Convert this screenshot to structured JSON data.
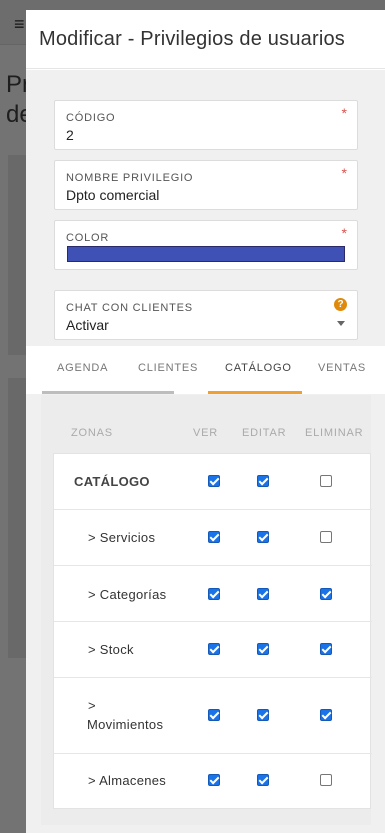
{
  "modal": {
    "title": "Modificar - Privilegios de usuarios"
  },
  "form": {
    "codigo": {
      "label": "CÓDIGO",
      "value": "2",
      "required_mark": "*"
    },
    "nombre": {
      "label": "NOMBRE PRIVILEGIO",
      "value": "Dpto comercial",
      "required_mark": "*"
    },
    "color": {
      "label": "COLOR",
      "value": "#3f51b5",
      "required_mark": "*"
    },
    "chat": {
      "label": "CHAT CON CLIENTES",
      "value": "Activar",
      "help": "?"
    }
  },
  "tabs": [
    {
      "label": "AGENDA",
      "state": "inactive"
    },
    {
      "label": "CLIENTES",
      "state": "inactive"
    },
    {
      "label": "CATÁLOGO",
      "state": "active"
    },
    {
      "label": "VENTAS",
      "state": "inactive"
    }
  ],
  "colors": {
    "accent_tab": "#f0a030",
    "inactive_tab_line": "#bdbdbd",
    "checkbox": "#1a73e8"
  },
  "permissions": {
    "headers": [
      "ZONAS",
      "VER",
      "EDITAR",
      "ELIMINAR"
    ],
    "rows": [
      {
        "zone": "CATÁLOGO",
        "ver": true,
        "editar": true,
        "eliminar": false
      },
      {
        "zone": "> Servicios",
        "ver": true,
        "editar": true,
        "eliminar": false
      },
      {
        "zone": "> Categorías",
        "ver": true,
        "editar": true,
        "eliminar": true
      },
      {
        "zone": "> Stock",
        "ver": true,
        "editar": true,
        "eliminar": true
      },
      {
        "zone": "> Movimientos",
        "zone_line1": ">",
        "zone_line2": "Movimientos",
        "ver": true,
        "editar": true,
        "eliminar": true
      },
      {
        "zone": "> Almacenes",
        "ver": true,
        "editar": true,
        "eliminar": false
      }
    ]
  },
  "background": {
    "menu_icon": "≡",
    "title_fragment_1": "Pr",
    "title_fragment_2": "de"
  }
}
